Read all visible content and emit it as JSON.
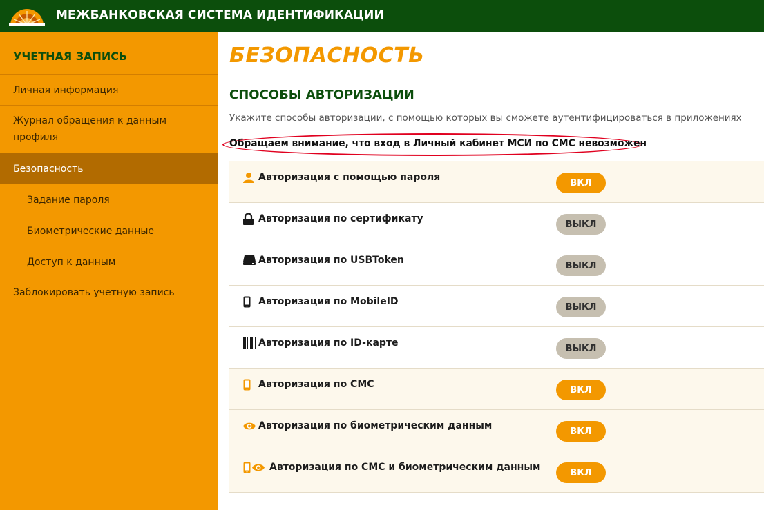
{
  "header": {
    "title": "МЕЖБАНКОВСКАЯ СИСТЕМА ИДЕНТИФИКАЦИИ",
    "logo_icon": "sunrise-logo"
  },
  "sidebar": {
    "heading": "УЧЕТНАЯ ЗАПИСЬ",
    "items": [
      {
        "label": "Личная информация"
      },
      {
        "label": "Журнал обращения к данным профиля"
      },
      {
        "label": "Безопасность",
        "active": true
      },
      {
        "label": "Задание пароля"
      },
      {
        "label": "Биометрические данные"
      },
      {
        "label": "Доступ к данным"
      },
      {
        "label": "Заблокировать учетную запись"
      }
    ]
  },
  "main": {
    "title": "БЕЗОПАСНОСТЬ",
    "section_title": "СПОСОБЫ АВТОРИЗАЦИИ",
    "section_desc": "Укажите способы авторизации, с помощью которых вы сможете аутентифицироваться в приложениях",
    "notice": "Обращаем внимание, что вход в Личный кабинет МСИ по СМС невозможен",
    "methods": [
      {
        "label": "Авторизация с помощью пароля",
        "icon": "user-icon",
        "state": "ВКЛ"
      },
      {
        "label": "Авторизация по сертификату",
        "icon": "lock-icon",
        "state": "ВЫКЛ"
      },
      {
        "label": "Авторизация по USBToken",
        "icon": "usb-drive-icon",
        "state": "ВЫКЛ"
      },
      {
        "label": "Авторизация по MobileID",
        "icon": "mobile-phone-icon",
        "state": "ВЫКЛ"
      },
      {
        "label": "Авторизация по ID-карте",
        "icon": "barcode-icon",
        "state": "ВЫКЛ"
      },
      {
        "label": "Авторизация по СМС",
        "icon": "mobile-phone-icon",
        "state": "ВКЛ"
      },
      {
        "label": "Авторизация по биометрическим данным",
        "icon": "eye-icon",
        "state": "ВКЛ"
      },
      {
        "label": "Авторизация по СМС и биометрическим данным",
        "icon": "phone-and-eye-icon",
        "state": "ВКЛ"
      }
    ]
  },
  "colors": {
    "header_bg": "#0c4e0c",
    "sidebar_bg": "#f39800",
    "sidebar_active_bg": "#b26b00",
    "accent": "#f39800",
    "toggle_off": "#c6bfb0",
    "notice_outline": "#e0001f"
  }
}
